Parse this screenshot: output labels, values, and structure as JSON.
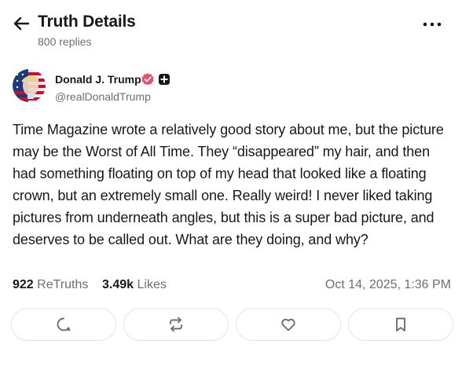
{
  "header": {
    "title": "Truth Details",
    "subtitle": "800 replies",
    "back_icon": "arrow-left-icon",
    "more_icon": "more-horizontal-icon"
  },
  "post": {
    "author_name": "Donald J. Trump",
    "author_handle": "@realDonaldTrump",
    "verified_badge_color": "#e84f6e",
    "text": "Time Magazine wrote a relatively good story about me, but the picture may be the Worst of All Time. They “disappeared” my hair, and then had something floating on top of my head that looked like a floating crown, but an extremely small one. Really weird! I never liked taking pictures from underneath angles, but this is a super bad picture, and deserves to be called out. What are they doing, and why?",
    "retruths_count": "922",
    "retruths_label": "ReTruths",
    "likes_count": "3.49k",
    "likes_label": "Likes",
    "timestamp": "Oct 14, 2025, 1:36 PM"
  },
  "actions": {
    "reply_icon": "comment-icon",
    "retruth_icon": "repost-icon",
    "like_icon": "heart-icon",
    "bookmark_icon": "bookmark-icon"
  }
}
